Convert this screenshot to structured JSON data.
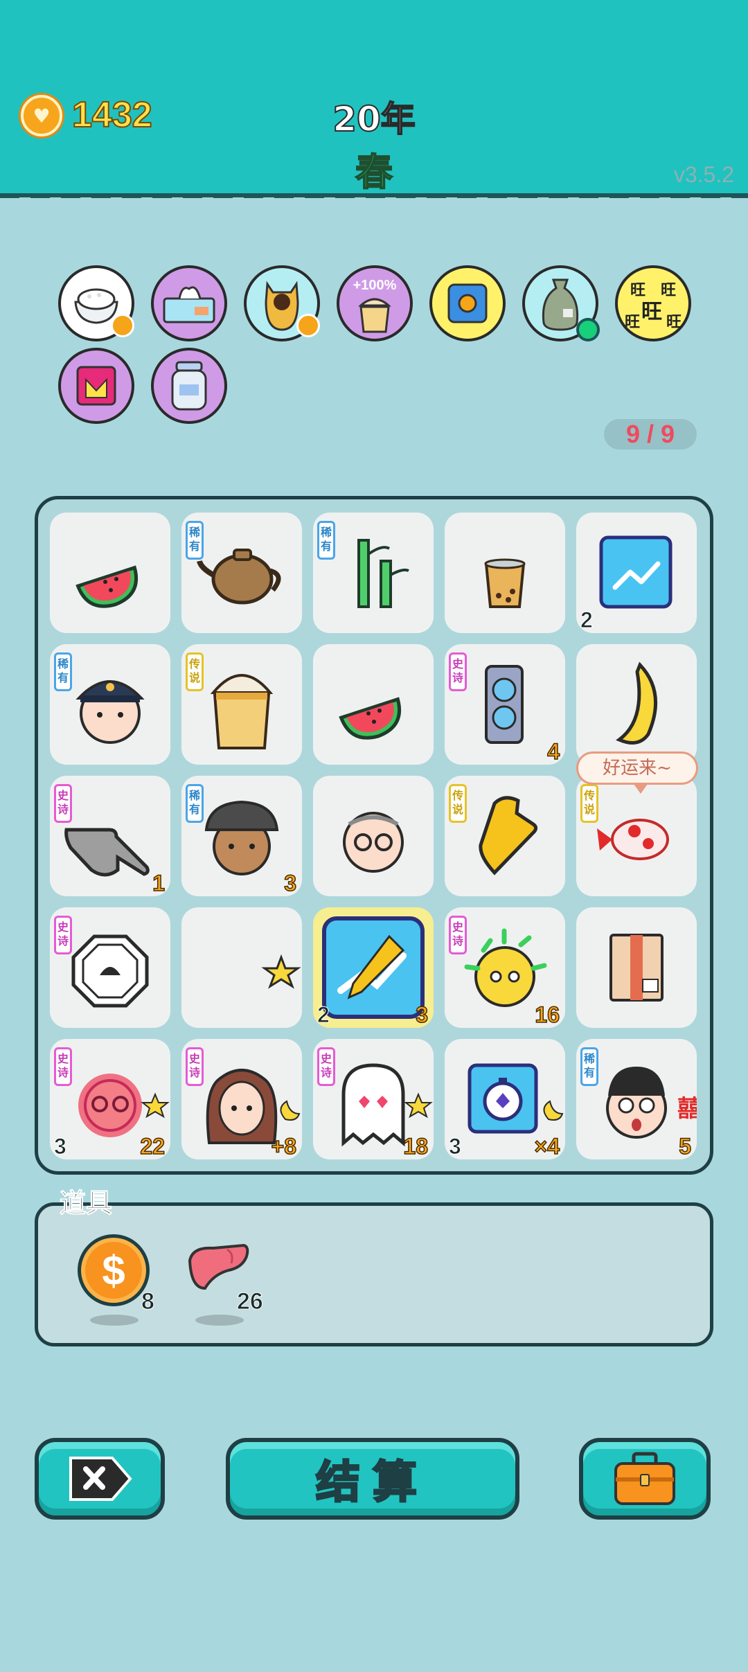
{
  "header": {
    "coins": "1432",
    "coin_icon": "heart-coin-icon",
    "year": "20年",
    "season": "春",
    "version": "v3.5.2"
  },
  "status_effects": [
    {
      "icon": "rice-bowl-icon",
      "bg": "#ffffff"
    },
    {
      "icon": "tissue-box-icon",
      "bg": "#cf9be6"
    },
    {
      "icon": "cat-icon",
      "bg": "#cf9be6"
    },
    {
      "icon": "milk-tea-boost-icon",
      "bg": "#cf9be6",
      "label": "+100%"
    },
    {
      "icon": "safe-icon",
      "bg": "#fff26a"
    },
    {
      "icon": "money-bag-icon",
      "bg": "#b5eef2"
    },
    {
      "icon": "wang-tiles-icon",
      "bg": "#fff26a",
      "label": "旺"
    },
    {
      "icon": "pink-box-icon",
      "bg": "#cf9be6"
    },
    {
      "icon": "jar-icon",
      "bg": "#cf9be6"
    }
  ],
  "capacity": "9 / 9",
  "board": {
    "rows": [
      [
        {
          "icon": "watermelon-icon"
        },
        {
          "icon": "teapot-icon",
          "rarity": "稀有"
        },
        {
          "icon": "bamboo-icon",
          "rarity": "稀有"
        },
        {
          "icon": "milk-tea-cup-icon"
        },
        {
          "icon": "trend-chart-icon",
          "left": "2"
        }
      ],
      [
        {
          "icon": "police-boy-icon",
          "rarity": "稀有"
        },
        {
          "icon": "big-milk-tea-icon",
          "rarity": "传说"
        },
        {
          "icon": "watermelon-icon"
        },
        {
          "icon": "graphics-card-icon",
          "rarity": "史诗",
          "right": "4"
        },
        {
          "icon": "banana-icon"
        }
      ],
      [
        {
          "icon": "gray-pointing-hand-icon",
          "rarity": "史诗",
          "right": "1"
        },
        {
          "icon": "bucket-hat-man-icon",
          "rarity": "稀有",
          "right": "3"
        },
        {
          "icon": "old-man-glasses-icon"
        },
        {
          "icon": "gold-pointing-hand-icon",
          "rarity": "传说"
        },
        {
          "icon": "koi-fish-icon",
          "rarity": "传说"
        }
      ],
      [
        {
          "icon": "bagua-icon",
          "rarity": "史诗"
        },
        {
          "icon": "star-icon"
        },
        {
          "icon": "sword-chart-icon",
          "left": "2",
          "right": "3",
          "selected": true
        },
        {
          "icon": "cactus-face-icon",
          "rarity": "史诗",
          "right": "16"
        },
        {
          "icon": "package-box-icon"
        }
      ],
      [
        {
          "icon": "red-glasses-face-icon",
          "rarity": "史诗",
          "left": "3",
          "right": "22"
        },
        {
          "icon": "braid-girl-icon",
          "rarity": "史诗",
          "right": "+8"
        },
        {
          "icon": "ghost-icon",
          "rarity": "史诗",
          "right": "18"
        },
        {
          "icon": "stopwatch-icon",
          "left": "3",
          "right": "×4"
        },
        {
          "icon": "surprised-boy-icon",
          "rarity": "稀有",
          "right": "5"
        }
      ]
    ]
  },
  "bubble_text": "好运来~",
  "items": {
    "title": "道具",
    "list": [
      {
        "icon": "dollar-coin-icon",
        "count": "8"
      },
      {
        "icon": "liver-icon",
        "count": "26"
      }
    ]
  },
  "buttons": {
    "settle": "结算",
    "exit_icon": "close-tag-icon",
    "bag_icon": "briefcase-icon"
  }
}
